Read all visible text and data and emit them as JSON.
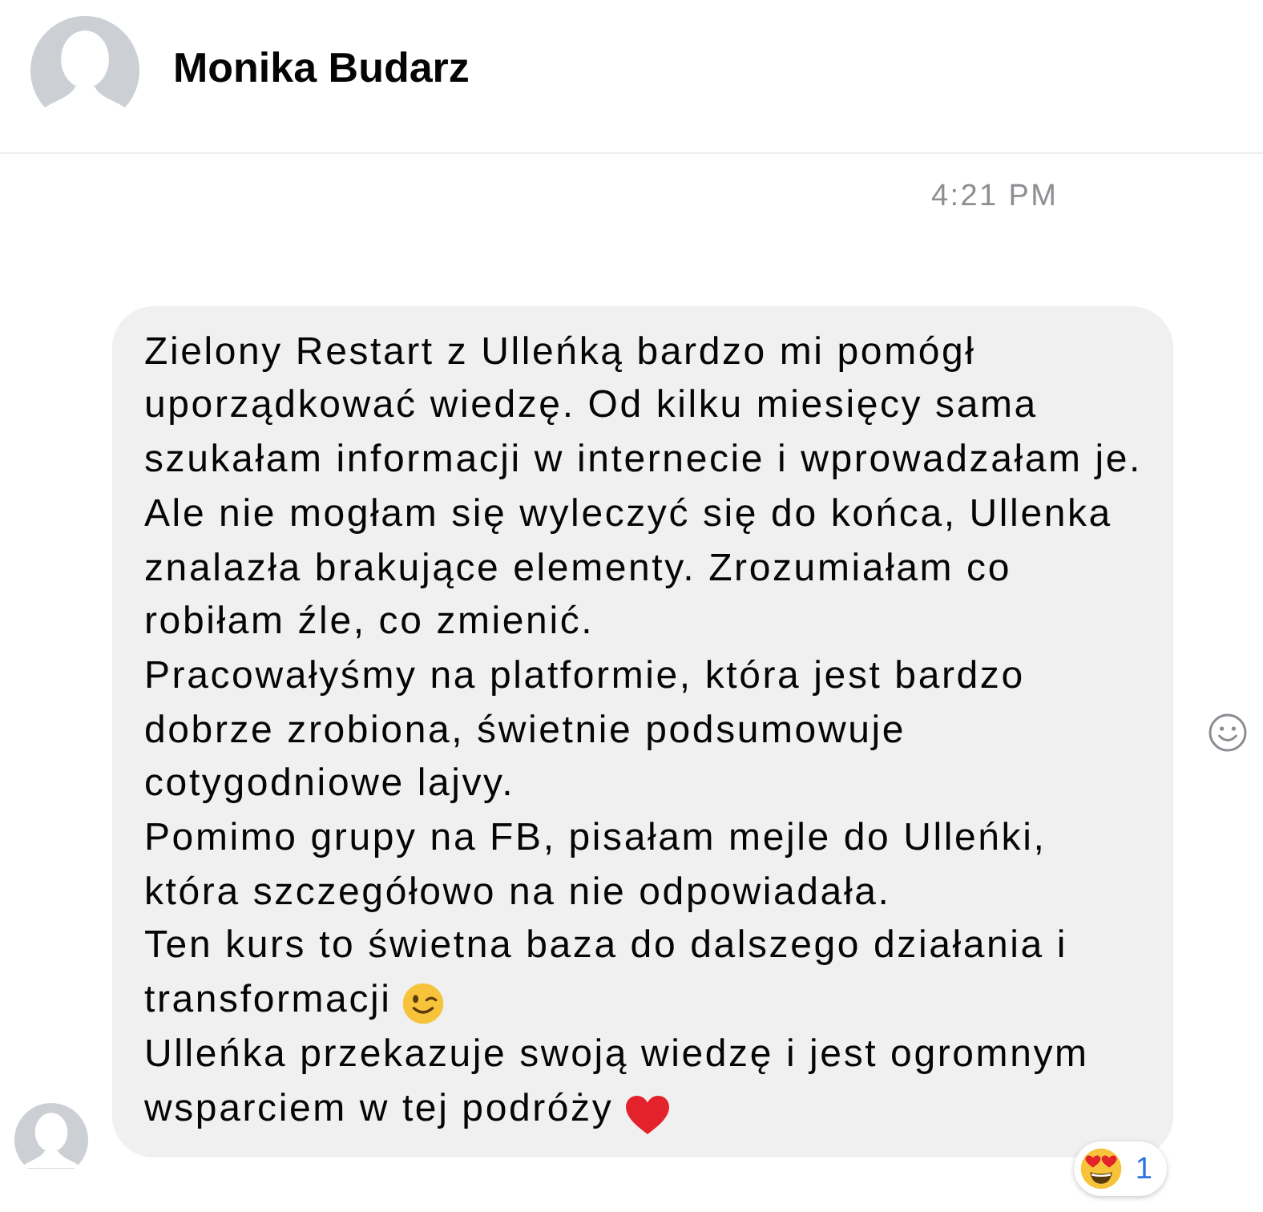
{
  "header": {
    "name": "Monika Budarz"
  },
  "timestamp": "4:21 PM",
  "message": {
    "paragraphs": [
      {
        "kind": "plain",
        "text": "Zielony Restart z Ulleńką bardzo mi pomógł uporządkować wiedzę. Od kilku miesięcy sama szukałam informacji w internecie i wprowadzałam je."
      },
      {
        "kind": "plain",
        "text": "Ale nie mogłam się wyleczyć się do końca, Ullenka znalazła brakujące elementy. Zrozumiałam co robiłam źle, co zmienić."
      },
      {
        "kind": "plain",
        "text": "Pracowałyśmy na platformie, która jest bardzo dobrze zrobiona, świetnie podsumowuje cotygodniowe lajvy."
      },
      {
        "kind": "plain",
        "text": "Pomimo grupy na FB, pisałam mejle do Ulleńki,"
      },
      {
        "kind": "plain",
        "text": "która szczegółowo na nie odpowiadała."
      },
      {
        "kind": "plain",
        "text": "Ten kurs to świetna baza do dalszego działania i"
      },
      {
        "kind": "wink",
        "text": "transformacji"
      },
      {
        "kind": "plain",
        "text": "Ulleńka przekazuje swoją wiedzę i jest ogromnym"
      },
      {
        "kind": "heart",
        "text": "wsparciem w tej podróży"
      }
    ],
    "reaction": {
      "count": "1"
    }
  }
}
